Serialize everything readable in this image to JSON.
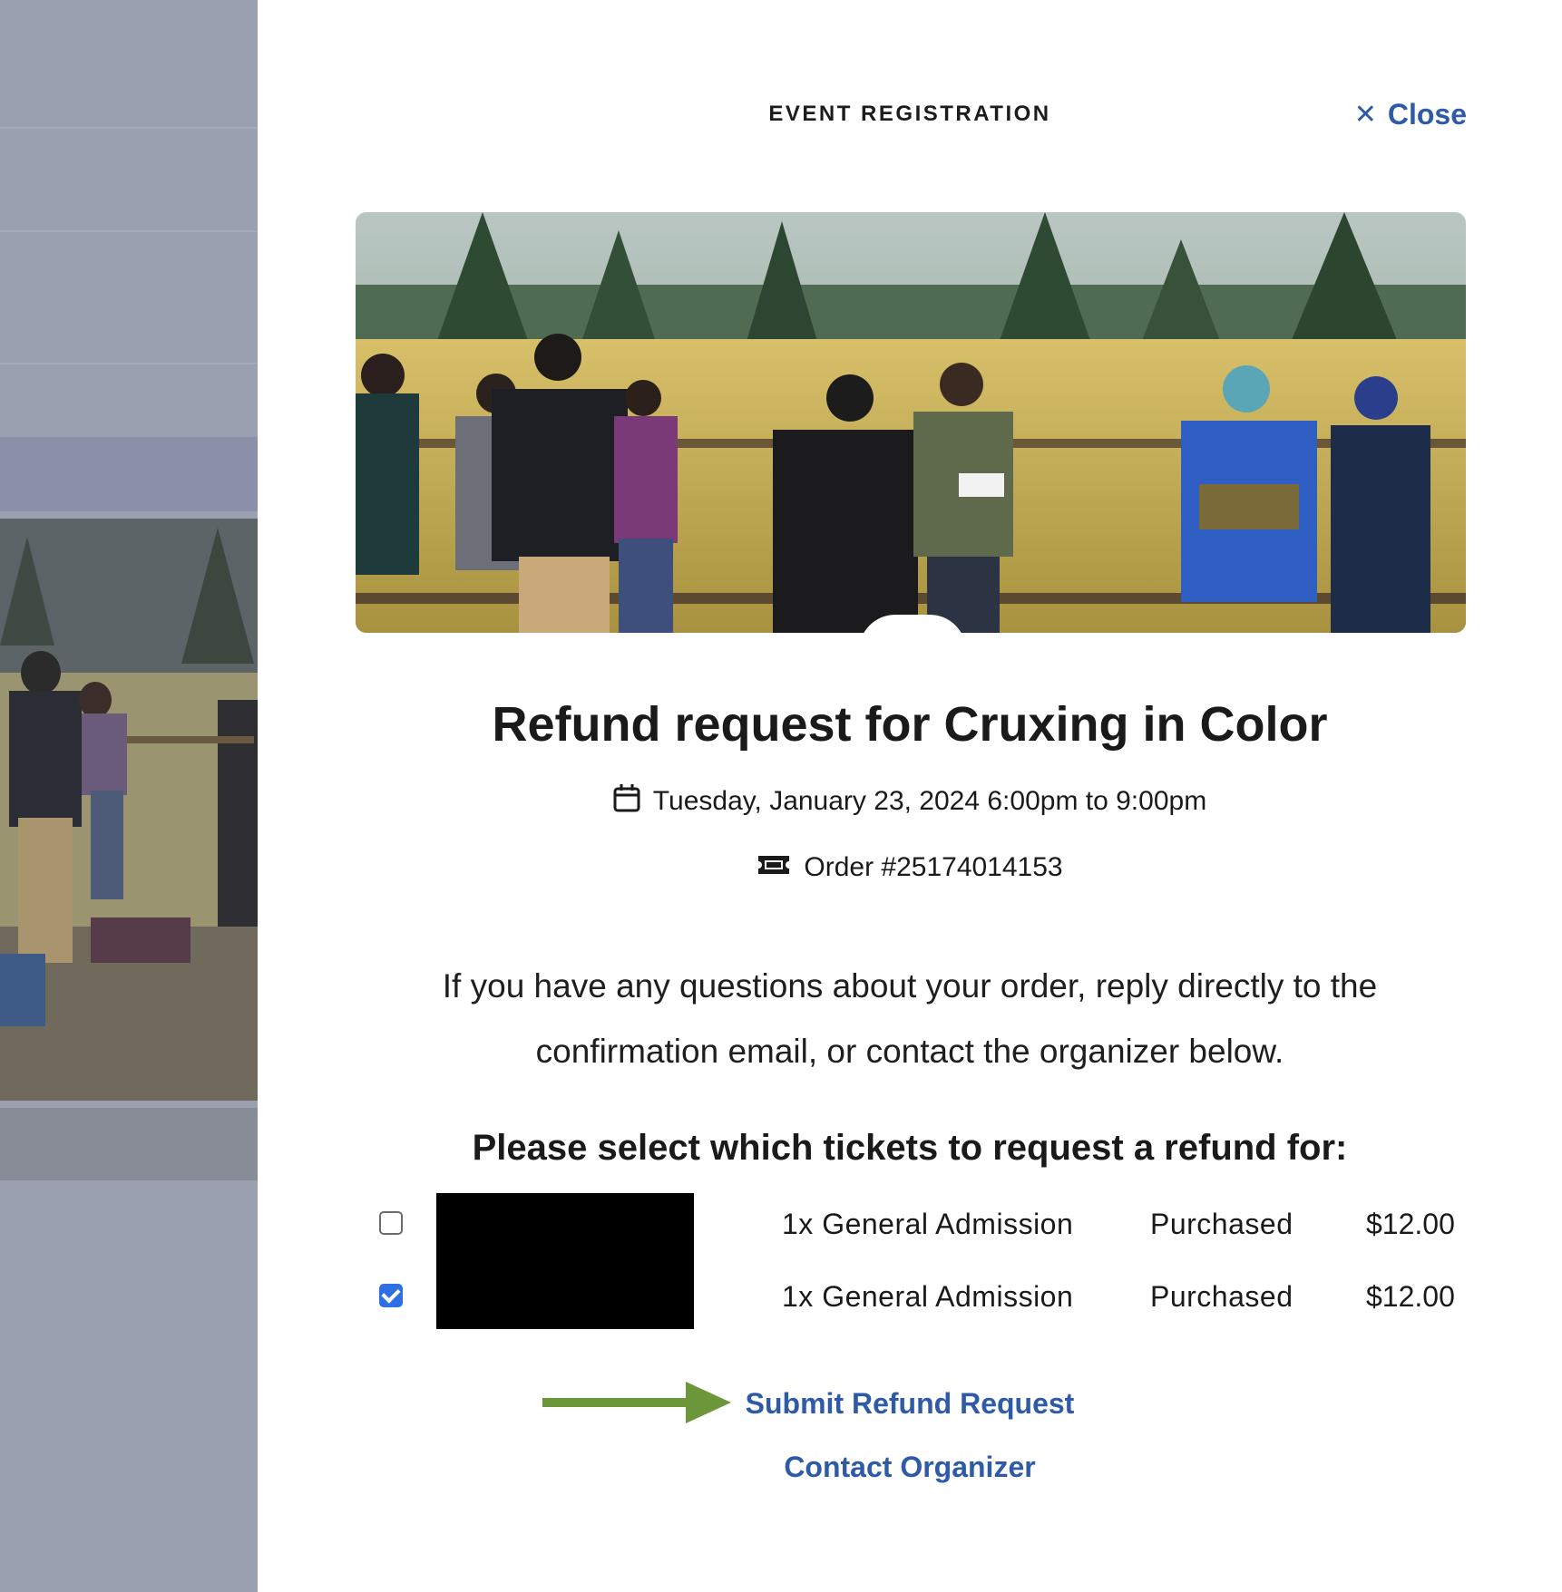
{
  "modal": {
    "title": "EVENT REGISTRATION",
    "close_label": "Close"
  },
  "event": {
    "heading": "Refund request for Cruxing in Color",
    "datetime": "Tuesday, January 23, 2024 6:00pm to 9:00pm",
    "order": "Order #25174014153"
  },
  "info_text": "If you have any questions about your order, reply directly to the confirmation email, or contact the organizer below.",
  "select_heading": "Please select which tickets to request a refund for:",
  "tickets": [
    {
      "name": "1x General Admission",
      "status": "Purchased",
      "price": "$12.00",
      "checked": false
    },
    {
      "name": "1x General Admission",
      "status": "Purchased",
      "price": "$12.00",
      "checked": true
    }
  ],
  "actions": {
    "submit_label": "Submit Refund Request",
    "contact_label": "Contact Organizer"
  },
  "colors": {
    "link": "#2e5aa8",
    "arrow": "#6b963a",
    "checkbox_checked": "#2f6fe4"
  },
  "icons": {
    "close": "close-icon",
    "calendar": "calendar-icon",
    "ticket": "ticket-icon",
    "arrow": "arrow-right-icon"
  }
}
